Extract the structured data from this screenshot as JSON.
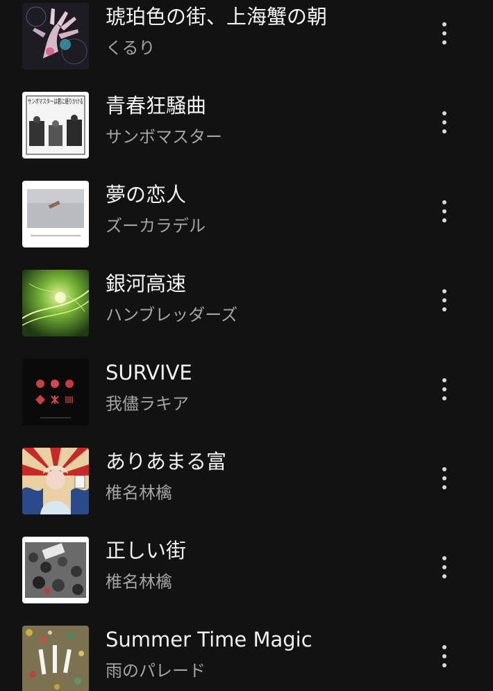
{
  "tracks": [
    {
      "title": "琥珀色の街、上海蟹の朝",
      "artist": "くるり"
    },
    {
      "title": "青春狂騒曲",
      "artist": "サンボマスター",
      "art_text": "サンボマスターは君に語りかける"
    },
    {
      "title": "夢の恋人",
      "artist": "ズーカラデル"
    },
    {
      "title": "銀河高速",
      "artist": "ハンブレッダーズ"
    },
    {
      "title": "SURVIVE",
      "artist": "我儘ラキア"
    },
    {
      "title": "ありあまる富",
      "artist": "椎名林檎"
    },
    {
      "title": "正しい街",
      "artist": "椎名林檎"
    },
    {
      "title": "Summer Time Magic",
      "artist": "雨のパレード"
    }
  ],
  "icons": {
    "more": "more-vert-icon"
  },
  "colors": {
    "background": "#121212",
    "title": "#f2f2f2",
    "artist": "#a4a4a4"
  }
}
